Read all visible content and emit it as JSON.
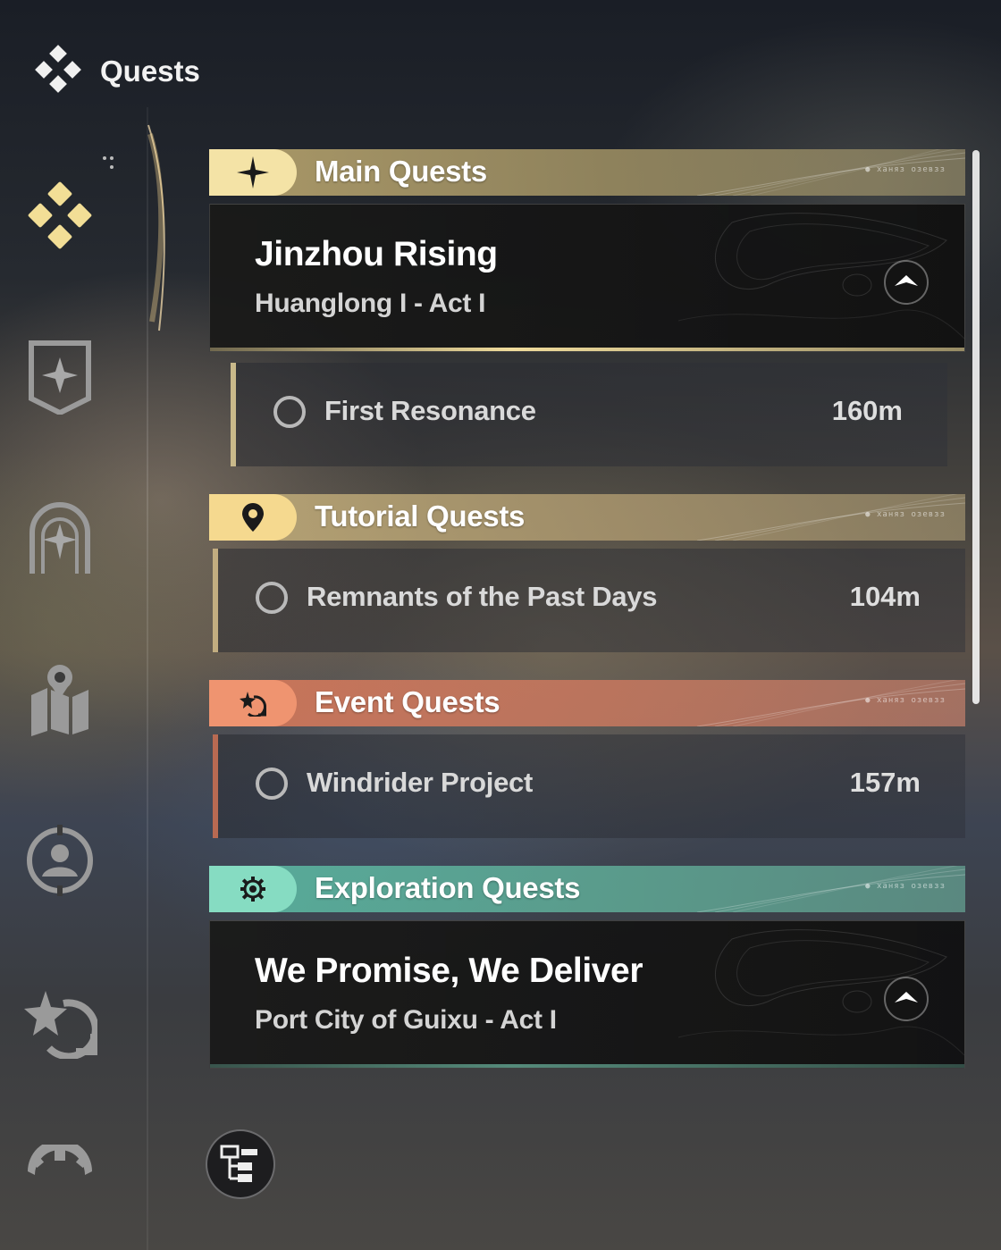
{
  "header": {
    "title": "Quests",
    "icon": "quests-diamond-icon"
  },
  "sidebar": {
    "items": [
      {
        "name": "quests",
        "icon": "quests-diamond-icon",
        "active": true
      },
      {
        "name": "main-banner",
        "icon": "banner-star-icon",
        "active": false
      },
      {
        "name": "archway",
        "icon": "arch-star-icon",
        "active": false
      },
      {
        "name": "map",
        "icon": "map-pin-icon",
        "active": false
      },
      {
        "name": "profile",
        "icon": "profile-target-icon",
        "active": false
      },
      {
        "name": "event",
        "icon": "star-refresh-icon",
        "active": false
      },
      {
        "name": "settings",
        "icon": "gear-icon",
        "active": false
      }
    ]
  },
  "categories": {
    "main": {
      "title": "Main Quests",
      "icon": "sparkle-icon",
      "color": "#f0dc9c",
      "code": "● ханяз озевзз"
    },
    "tutorial": {
      "title": "Tutorial Quests",
      "icon": "location-pin-icon",
      "color": "#f3d28c",
      "code": "● ханяз озевзз"
    },
    "event": {
      "title": "Event Quests",
      "icon": "star-refresh-icon",
      "color": "#e98e6a",
      "code": "● ханяз озевзз"
    },
    "exploration": {
      "title": "Exploration Quests",
      "icon": "gear-cog-icon",
      "color": "#7dd6bc",
      "code": "● ханяз озевзз"
    }
  },
  "quests": {
    "main_card": {
      "title": "Jinzhou Rising",
      "subtitle": "Huanglong I - Act I",
      "track_icon": "up-arrow-track-icon"
    },
    "main_step": {
      "name": "First Resonance",
      "distance": "160m"
    },
    "tutorial_step": {
      "name": "Remnants of the Past Days",
      "distance": "104m"
    },
    "event_step": {
      "name": "Windrider Project",
      "distance": "157m"
    },
    "exploration_card": {
      "title": "We Promise, We Deliver",
      "subtitle": "Port City of Guixu - Act I",
      "track_icon": "up-arrow-track-icon"
    }
  },
  "footer": {
    "tree_button_icon": "quest-tree-icon"
  },
  "colors": {
    "gold": "#f0dc9c",
    "orange": "#e98e6a",
    "teal": "#7dd6bc",
    "dark_card": "#161616"
  }
}
